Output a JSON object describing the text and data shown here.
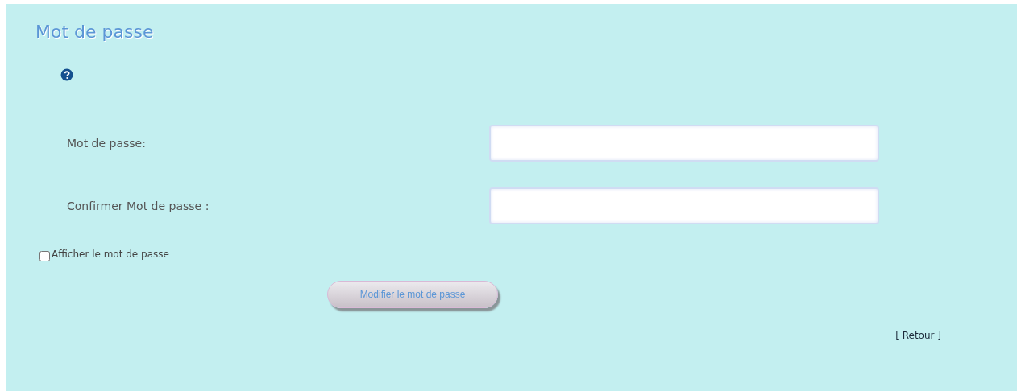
{
  "title": "Mot de passe",
  "fields": [
    {
      "label": "Mot de passe:"
    },
    {
      "label": "Confirmer Mot de passe :"
    }
  ],
  "show_password": {
    "label": "Afficher le mot de passe",
    "checked": false
  },
  "submit": {
    "label": "Modifier le mot de passe"
  },
  "back_link": {
    "label": "[ Retour ]"
  }
}
